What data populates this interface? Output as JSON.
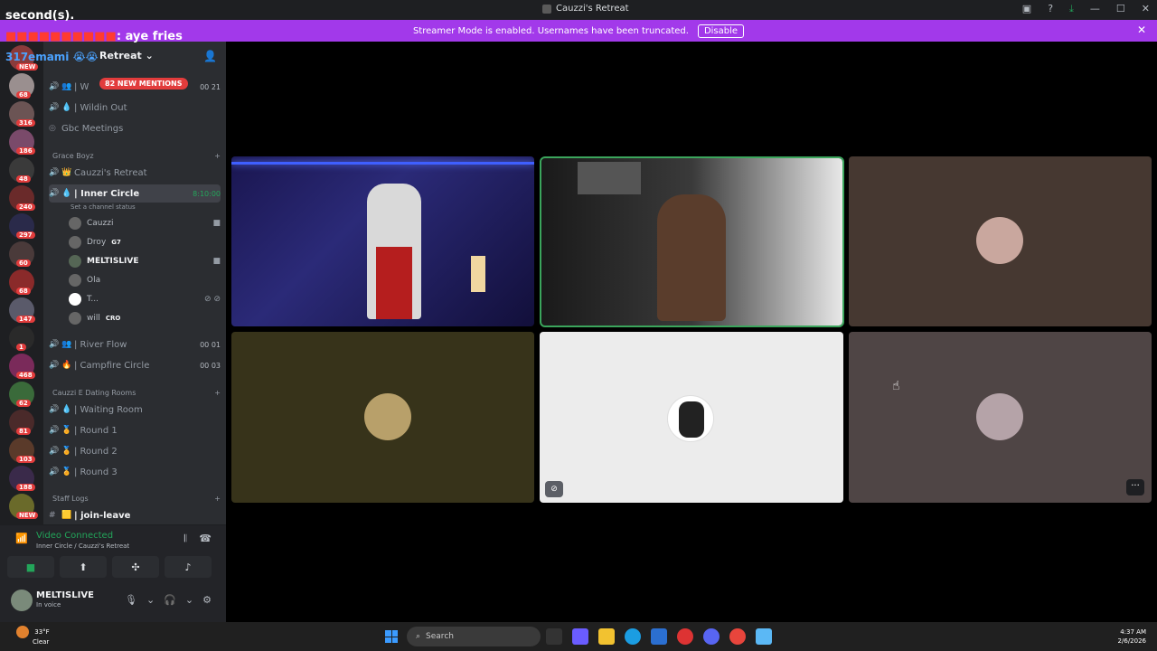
{
  "window": {
    "title": "Cauzzi's Retreat"
  },
  "banner": {
    "text": "Streamer Mode is enabled. Usernames have been truncated.",
    "button": "Disable"
  },
  "overlay": {
    "line1": "second(s).",
    "user": "aye fries",
    "line3": "317emami"
  },
  "server": {
    "name": "Retreat",
    "mentions": "82 NEW MENTIONS"
  },
  "channels": {
    "top1": {
      "name": "| W",
      "count": "00 21"
    },
    "wildin": "| Wildin Out",
    "gbc": "Gbc Meetings",
    "cat_grace": "Grace Boyz",
    "cauzzis": "Cauzzi's Retreat",
    "inner": {
      "name": "| Inner Circle",
      "time": "8:10:00",
      "status": "Set a channel status"
    },
    "members": [
      {
        "name": "Cauzzi"
      },
      {
        "name": "Droy",
        "tag": "G7"
      },
      {
        "name": "MELTISLIVE"
      },
      {
        "name": "Ola"
      },
      {
        "name": "T..."
      },
      {
        "name": "will",
        "tag": "CRO"
      }
    ],
    "river": {
      "name": "| River Flow",
      "count": "00 01"
    },
    "campfire": {
      "name": "| Campfire Circle",
      "count": "00 03"
    },
    "cat_dating": "Cauzzi E Dating Rooms",
    "waiting": "| Waiting Room",
    "round1": "| Round 1",
    "round2": "| Round 2",
    "round3": "| Round 3",
    "cat_staff": "Staff Logs",
    "joinleave": "| join-leave"
  },
  "guild_badges": [
    "NEW",
    "68",
    "316",
    "186",
    "48",
    "240",
    "297",
    "60",
    "68",
    "147",
    "1",
    "468",
    "62",
    "81",
    "103",
    "188",
    "NEW"
  ],
  "voice": {
    "status": "Video Connected",
    "location": "Inner Circle / Cauzzi's Retreat"
  },
  "user": {
    "name": "MELTISLIVE",
    "status": "In voice"
  },
  "taskbar": {
    "temp": "33°F",
    "condition": "Clear",
    "search": "Search",
    "time": "4:37 AM",
    "date": "2/6/2026"
  },
  "colors": {
    "accent": "#a239ea",
    "speaking": "#3ba55c",
    "brand": "#5865f2"
  }
}
